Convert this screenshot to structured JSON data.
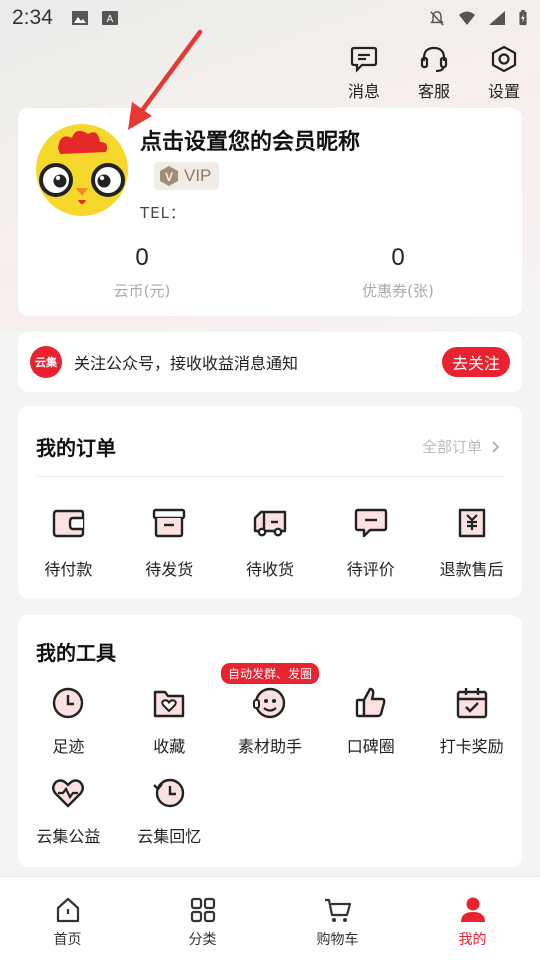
{
  "status_bar": {
    "time": "2:34"
  },
  "header": {
    "actions": [
      {
        "label": "消息",
        "icon": "message-icon"
      },
      {
        "label": "客服",
        "icon": "headset-icon"
      },
      {
        "label": "设置",
        "icon": "settings-icon"
      }
    ]
  },
  "profile": {
    "nickname_prompt": "点击设置您的会员昵称",
    "vip_label": "VIP",
    "tel_label": "TEL：",
    "stats": [
      {
        "value": "0",
        "label": "云币(元)"
      },
      {
        "value": "0",
        "label": "优惠券(张)"
      }
    ]
  },
  "follow_banner": {
    "logo_text": "云集",
    "text": "关注公众号，接收收益消息通知",
    "button": "去关注"
  },
  "orders": {
    "title": "我的订单",
    "all_label": "全部订单",
    "items": [
      {
        "label": "待付款",
        "icon": "wallet-icon"
      },
      {
        "label": "待发货",
        "icon": "package-icon"
      },
      {
        "label": "待收货",
        "icon": "truck-icon"
      },
      {
        "label": "待评价",
        "icon": "comment-icon"
      },
      {
        "label": "退款售后",
        "icon": "refund-icon"
      }
    ]
  },
  "tools": {
    "title": "我的工具",
    "items": [
      {
        "label": "足迹",
        "icon": "clock-icon"
      },
      {
        "label": "收藏",
        "icon": "favorite-folder-icon"
      },
      {
        "label": "素材助手",
        "icon": "assistant-icon",
        "tag": "自动发群、发圈"
      },
      {
        "label": "口碑圈",
        "icon": "thumbs-up-icon"
      },
      {
        "label": "打卡奖励",
        "icon": "calendar-check-icon"
      },
      {
        "label": "云集公益",
        "icon": "heart-icon"
      },
      {
        "label": "云集回忆",
        "icon": "history-icon"
      }
    ]
  },
  "tabbar": {
    "items": [
      {
        "label": "首页",
        "icon": "home-icon"
      },
      {
        "label": "分类",
        "icon": "category-icon"
      },
      {
        "label": "购物车",
        "icon": "cart-icon"
      },
      {
        "label": "我的",
        "icon": "profile-icon",
        "active": true
      }
    ]
  },
  "colors": {
    "accent": "#e8232f",
    "background": "#f4f4f4"
  }
}
